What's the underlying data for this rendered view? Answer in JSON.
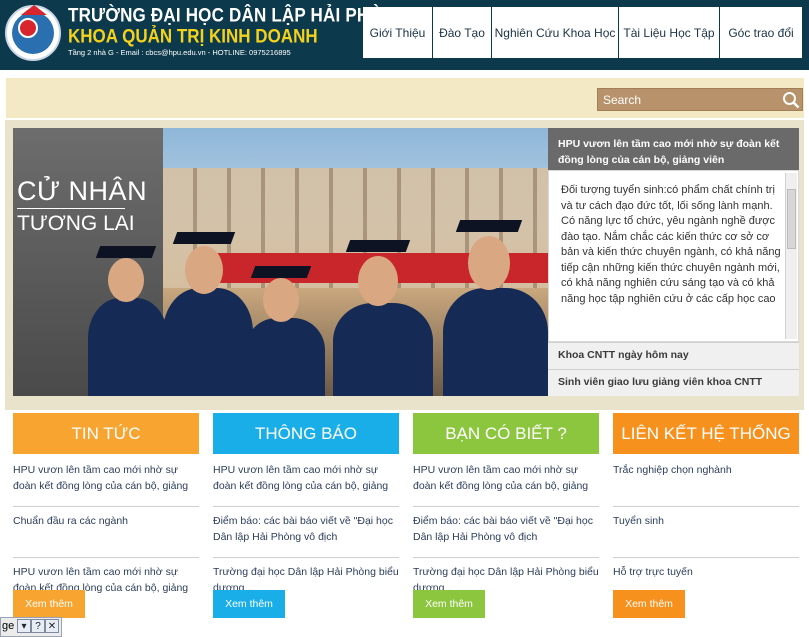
{
  "header": {
    "school_name": "TRƯỜNG ĐẠI HỌC DÂN LẬP HẢI PHÒNG",
    "faculty_name": "KHOA QUẢN TRỊ KINH DOANH",
    "contact": "Tầng 2 nhà G - Email : cbcs@hpu.edu.vn - HOTLINE: 0975216895"
  },
  "nav": {
    "items": [
      {
        "label": "Giới Thiệu"
      },
      {
        "label": "Đào Tạo"
      },
      {
        "label": "Nghiên Cứu Khoa Học"
      },
      {
        "label": "Tài Liệu Học Tập"
      },
      {
        "label": "Góc trao đổi"
      }
    ]
  },
  "search": {
    "placeholder": "Search"
  },
  "slider": {
    "caption_line1": "CỬ NHÂN",
    "caption_line2": "TƯƠNG LAI",
    "active_title": "HPU vươn lên tầm cao mới nhờ sự đoàn kết đồng lòng của cán bộ, giảng viên",
    "active_body": "Đối tượng tuyển sinh:có phẩm chất chính trị và tư cách đạo đức tốt, lối sống lành mạnh. Có năng lực tổ chức, yêu ngành nghề được đào tạo. Nắm chắc các kiến thức cơ sở cơ bản và kiến thức chuyên ngành, có khả năng tiếp cận những kiến thức chuyên ngành mới, có khả năng nghiên cứu sáng tạo và có khả năng học tập nghiên cứu ở các cấp học cao",
    "other_titles": [
      "Khoa CNTT ngày hôm nay",
      "Sinh viên giao lưu giảng viên khoa CNTT"
    ]
  },
  "columns": [
    {
      "title": "TIN TỨC",
      "color": "#f7a530",
      "items": [
        "HPU vươn lên tầm cao mới nhờ sự đoàn kết đồng lòng của cán bộ, giảng",
        "Chuẩn đầu ra các ngành",
        "HPU vươn lên tầm cao mới nhờ sự đoàn kết đồng lòng của cán bộ, giảng"
      ],
      "more": "Xem thêm"
    },
    {
      "title": "THÔNG BÁO",
      "color": "#1aaee8",
      "items": [
        "HPU vươn lên tầm cao mới nhờ sự đoàn kết đồng lòng của cán bộ, giảng",
        "Điểm báo: các bài báo viết về \"Đại học Dân lập Hải Phòng vô địch",
        "Trường đại học Dân lập Hải Phòng biểu dương .."
      ],
      "more": "Xem thêm"
    },
    {
      "title": "BẠN CÓ BIẾT ?",
      "color": "#8cc63e",
      "items": [
        "HPU vươn lên tầm cao mới nhờ sự đoàn kết đồng lòng của cán bộ, giảng",
        "Điểm báo: các bài báo viết về \"Đại học Dân lập Hải Phòng vô địch",
        "Trường đại học Dân lập Hải Phòng biểu dương .."
      ],
      "more": "Xem thêm"
    },
    {
      "title": "LIÊN KẾT HỆ THỐNG",
      "color": "#f7911e",
      "items": [
        "Trắc nghiệp chọn nghành",
        "Tuyển sinh",
        "Hỗ trợ trực tuyến"
      ],
      "more": "Xem thêm"
    }
  ],
  "browser_bar": {
    "text": "ge",
    "help": "?"
  }
}
